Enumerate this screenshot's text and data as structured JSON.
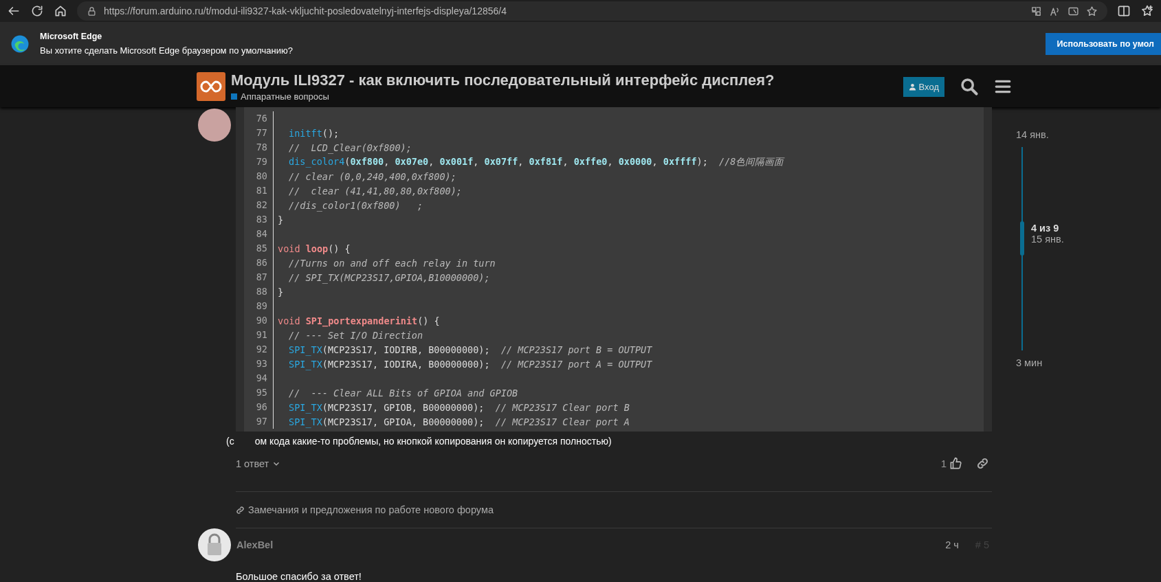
{
  "browser": {
    "url": "https://forum.arduino.ru/t/modul-ili9327-kak-vkljuchit-posledovatelnyj-interfejs-displeya/12856/4"
  },
  "banner": {
    "title": "Microsoft Edge",
    "message": "Вы хотите сделать Microsoft Edge браузером по умолчанию?",
    "button": "Использовать по умол"
  },
  "header": {
    "title": "Модуль ILI9327 - как включить последовательный интерфейс дисплея?",
    "category": "Аппаратные вопросы",
    "login": "Вход"
  },
  "post": {
    "code": [
      {
        "num": "76"
      },
      {
        "num": "77",
        "indented": true,
        "tokens": [
          {
            "kind": "fn",
            "text": "initft"
          },
          {
            "kind": "plain",
            "text": "();"
          }
        ]
      },
      {
        "num": "78",
        "indented": true,
        "tokens": [
          {
            "kind": "comment",
            "text": "//  LCD_Clear(0xf800);"
          }
        ]
      },
      {
        "num": "79",
        "indented": true,
        "tokens": [
          {
            "kind": "fn",
            "text": "dis_color4"
          },
          {
            "kind": "plain",
            "text": "("
          },
          {
            "kind": "num",
            "text": "0xf800"
          },
          {
            "kind": "plain",
            "text": ", "
          },
          {
            "kind": "num",
            "text": "0x07e0"
          },
          {
            "kind": "plain",
            "text": ", "
          },
          {
            "kind": "num",
            "text": "0x001f"
          },
          {
            "kind": "plain",
            "text": ", "
          },
          {
            "kind": "num",
            "text": "0x07ff"
          },
          {
            "kind": "plain",
            "text": ", "
          },
          {
            "kind": "num",
            "text": "0xf81f"
          },
          {
            "kind": "plain",
            "text": ", "
          },
          {
            "kind": "num",
            "text": "0xffe0"
          },
          {
            "kind": "plain",
            "text": ", "
          },
          {
            "kind": "num",
            "text": "0x0000"
          },
          {
            "kind": "plain",
            "text": ", "
          },
          {
            "kind": "num",
            "text": "0xffff"
          },
          {
            "kind": "plain",
            "text": ");  "
          },
          {
            "kind": "comment",
            "text": "//8色间隔画面"
          }
        ]
      },
      {
        "num": "80",
        "indented": true,
        "tokens": [
          {
            "kind": "comment",
            "text": "// clear (0,0,240,400,0xf800);"
          }
        ]
      },
      {
        "num": "81",
        "indented": true,
        "tokens": [
          {
            "kind": "comment",
            "text": "//  clear (41,41,80,80,0xf800);"
          }
        ]
      },
      {
        "num": "82",
        "indented": true,
        "tokens": [
          {
            "kind": "comment",
            "text": "//dis_color1(0xf800)   ;"
          }
        ]
      },
      {
        "num": "83",
        "indented": false,
        "tokens": [
          {
            "kind": "plain",
            "text": "}"
          }
        ]
      },
      {
        "num": "84"
      },
      {
        "num": "85",
        "indented": false,
        "tokens": [
          {
            "kind": "keyword",
            "text": "void "
          },
          {
            "kind": "title",
            "text": "loop"
          },
          {
            "kind": "plain",
            "text": "() {"
          }
        ]
      },
      {
        "num": "86",
        "indented": true,
        "tokens": [
          {
            "kind": "comment",
            "text": "//Turns on and off each relay in turn"
          }
        ]
      },
      {
        "num": "87",
        "indented": true,
        "tokens": [
          {
            "kind": "comment",
            "text": "// SPI_TX(MCP23S17,GPIOA,B10000000);"
          }
        ]
      },
      {
        "num": "88",
        "indented": false,
        "tokens": [
          {
            "kind": "plain",
            "text": "}"
          }
        ]
      },
      {
        "num": "89"
      },
      {
        "num": "90",
        "indented": false,
        "tokens": [
          {
            "kind": "keyword",
            "text": "void "
          },
          {
            "kind": "title",
            "text": "SPI_portexpanderinit"
          },
          {
            "kind": "plain",
            "text": "() {"
          }
        ]
      },
      {
        "num": "91",
        "indented": true,
        "tokens": [
          {
            "kind": "comment",
            "text": "// --- Set I/O Direction"
          }
        ]
      },
      {
        "num": "92",
        "indented": true,
        "tokens": [
          {
            "kind": "fn",
            "text": "SPI_TX"
          },
          {
            "kind": "plain",
            "text": "(MCP23S17, IODIRB, B00000000);  "
          },
          {
            "kind": "comment",
            "text": "// MCP23S17 port B = OUTPUT"
          }
        ]
      },
      {
        "num": "93",
        "indented": true,
        "tokens": [
          {
            "kind": "fn",
            "text": "SPI_TX"
          },
          {
            "kind": "plain",
            "text": "(MCP23S17, IODIRA, B00000000);  "
          },
          {
            "kind": "comment",
            "text": "// MCP23S17 port A = OUTPUT"
          }
        ]
      },
      {
        "num": "94"
      },
      {
        "num": "95",
        "indented": true,
        "tokens": [
          {
            "kind": "comment",
            "text": "//  --- Clear ALL Bits of GPIOA and GPIOB"
          }
        ]
      },
      {
        "num": "96",
        "indented": true,
        "tokens": [
          {
            "kind": "fn",
            "text": "SPI_TX"
          },
          {
            "kind": "plain",
            "text": "(MCP23S17, GPIOB, B00000000);  "
          },
          {
            "kind": "comment",
            "text": "// MCP23S17 Clear port B"
          }
        ]
      },
      {
        "num": "97",
        "indented": true,
        "tokens": [
          {
            "kind": "fn",
            "text": "SPI_TX"
          },
          {
            "kind": "plain",
            "text": "(MCP23S17, GPIOA, B00000000);  "
          },
          {
            "kind": "comment",
            "text": "// MCP23S17 Clear port A"
          }
        ]
      }
    ],
    "caption_start": "(с",
    "caption_rest": "ом кода какие-то проблемы, но кнопкой копирования он копируется полностью)",
    "replies": "1 ответ",
    "likes": "1"
  },
  "linked_topic": "Замечания и предложения по работе нового форума",
  "next_post": {
    "author": "AlexBel",
    "time": "2 ч",
    "number": "# 5",
    "text": "Большое спасибо за ответ!"
  },
  "timeline": {
    "start": "14 янв.",
    "position": "4 из 9",
    "position_date": "15 янв.",
    "end": "3 мин",
    "level": 0.44
  }
}
